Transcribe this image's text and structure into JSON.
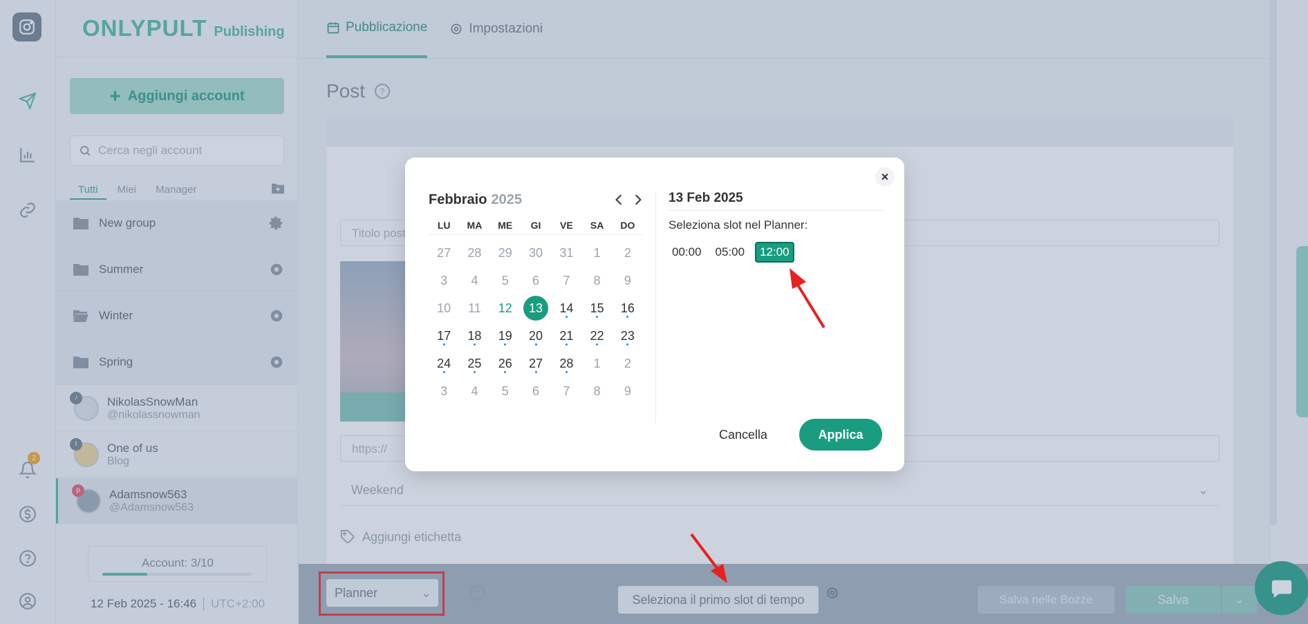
{
  "brand": {
    "name": "ONLYPULT",
    "product": "Publishing"
  },
  "rail": {
    "notifications_count": "2"
  },
  "sidebar": {
    "add_account_label": "Aggiungi account",
    "search_placeholder": "Cerca negli account",
    "filters": [
      "Tutti",
      "Miei",
      "Manager"
    ],
    "groups": [
      {
        "name": "New group"
      },
      {
        "name": "Summer"
      },
      {
        "name": "Winter"
      },
      {
        "name": "Spring"
      }
    ],
    "accounts": [
      {
        "name": "NikolasSnowMan",
        "handle": "@nikolassnowman",
        "network": "tiktok"
      },
      {
        "name": "One of us",
        "handle": "Blog",
        "network": "tumblr"
      },
      {
        "name": "Adamsnow563",
        "handle": "@Adamsnow563",
        "network": "pinterest"
      }
    ],
    "account_count_label": "Account: 3/10",
    "account_usage": 0.3,
    "datetime": "12 Feb 2025 - 16:46",
    "timezone": "UTC+2:00"
  },
  "main": {
    "tabs": [
      "Pubblicazione",
      "Impostazioni"
    ],
    "post_title": "Post",
    "title_placeholder": "Titolo post",
    "link_placeholder": "https://",
    "category": "Weekend",
    "tag_label": "Aggiungi etichetta"
  },
  "bottom": {
    "mode": "Planner",
    "slot_button": "Seleziona il primo slot di tempo",
    "drafts_button": "Salva nelle Bozze",
    "save_button": "Salva"
  },
  "modal": {
    "month": "Febbraio",
    "year": "2025",
    "weekdays": [
      "LU",
      "MA",
      "ME",
      "GI",
      "VE",
      "SA",
      "DO"
    ],
    "days": [
      {
        "d": "27",
        "muted": true
      },
      {
        "d": "28",
        "muted": true
      },
      {
        "d": "29",
        "muted": true
      },
      {
        "d": "30",
        "muted": true
      },
      {
        "d": "31",
        "muted": true
      },
      {
        "d": "1",
        "muted": true
      },
      {
        "d": "2",
        "muted": true
      },
      {
        "d": "3",
        "muted": true
      },
      {
        "d": "4",
        "muted": true
      },
      {
        "d": "5",
        "muted": true
      },
      {
        "d": "6",
        "muted": true
      },
      {
        "d": "7",
        "muted": true
      },
      {
        "d": "8",
        "muted": true
      },
      {
        "d": "9",
        "muted": true
      },
      {
        "d": "10",
        "muted": true
      },
      {
        "d": "11",
        "muted": true
      },
      {
        "d": "12",
        "today": true
      },
      {
        "d": "13",
        "selected": true
      },
      {
        "d": "14",
        "dot": true
      },
      {
        "d": "15",
        "dot": true
      },
      {
        "d": "16",
        "dot": true
      },
      {
        "d": "17",
        "dot": true
      },
      {
        "d": "18",
        "dot": true
      },
      {
        "d": "19",
        "dot": true
      },
      {
        "d": "20",
        "dot": true
      },
      {
        "d": "21",
        "dot": true
      },
      {
        "d": "22",
        "dot": true
      },
      {
        "d": "23",
        "dot": true
      },
      {
        "d": "24",
        "dot": true
      },
      {
        "d": "25",
        "dot": true
      },
      {
        "d": "26",
        "dot": true
      },
      {
        "d": "27",
        "dot": true
      },
      {
        "d": "28",
        "dot": true
      },
      {
        "d": "1",
        "muted": true
      },
      {
        "d": "2",
        "muted": true
      },
      {
        "d": "3",
        "muted": true
      },
      {
        "d": "4",
        "muted": true
      },
      {
        "d": "5",
        "muted": true
      },
      {
        "d": "6",
        "muted": true
      },
      {
        "d": "7",
        "muted": true
      },
      {
        "d": "8",
        "muted": true
      },
      {
        "d": "9",
        "muted": true
      }
    ],
    "selected_date": "13 Feb 2025",
    "slot_label": "Seleziona slot nel Planner:",
    "slots": [
      {
        "time": "00:00",
        "active": false
      },
      {
        "time": "05:00",
        "active": false
      },
      {
        "time": "12:00",
        "active": true
      }
    ],
    "cancel_label": "Cancella",
    "apply_label": "Applica"
  },
  "colors": {
    "accent": "#1a9c80",
    "annotation": "#e8201f"
  }
}
